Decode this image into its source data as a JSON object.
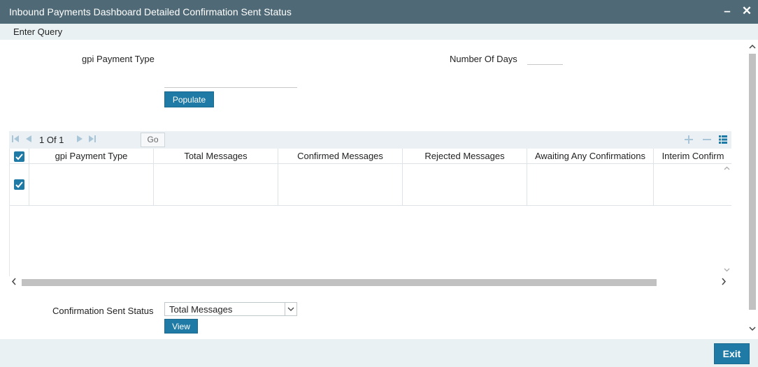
{
  "window": {
    "title": "Inbound Payments Dashboard Detailed Confirmation Sent Status",
    "minimize_symbol": "–",
    "close_symbol": "✕"
  },
  "menu": {
    "enter_query": "Enter Query"
  },
  "form": {
    "gpi_payment_type_label": "gpi Payment Type",
    "gpi_payment_type_value": "",
    "number_of_days_label": "Number Of Days",
    "number_of_days_value": "",
    "populate_label": "Populate"
  },
  "grid": {
    "pager": "1 Of 1",
    "go_label": "Go",
    "columns": [
      "gpi Payment Type",
      "Total Messages",
      "Confirmed Messages",
      "Rejected Messages",
      "Awaiting Any Confirmations",
      "Interim Confirm"
    ],
    "rows": [
      {
        "checked": true,
        "cells": [
          "",
          "",
          "",
          "",
          "",
          ""
        ]
      }
    ]
  },
  "status": {
    "label": "Confirmation Sent Status",
    "selected": "Total Messages",
    "view_label": "View"
  },
  "footer": {
    "exit_label": "Exit"
  },
  "icons": {
    "first_page": "first-page-icon",
    "prev_page": "prev-page-icon",
    "next_page": "next-page-icon",
    "last_page": "last-page-icon",
    "add_row": "plus-icon",
    "delete_row": "minus-icon",
    "single_view": "list-icon"
  },
  "colors": {
    "titlebar": "#4f6a76",
    "accent": "#1f7ba5",
    "toolbar_bg": "#eaf0f3",
    "footer_bg": "#eaf1f3"
  }
}
